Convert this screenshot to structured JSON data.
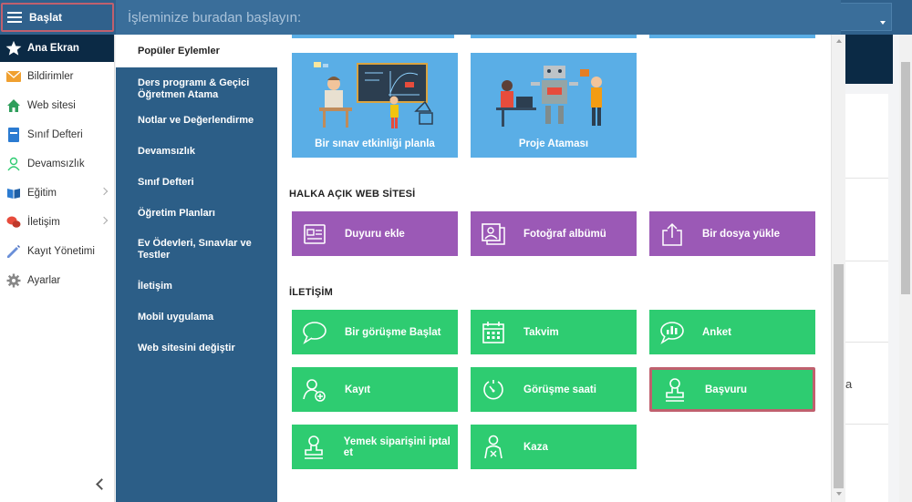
{
  "topbar": {
    "start_label": "Başlat",
    "search_placeholder": "İşleminize buradan başlayın:"
  },
  "sidebar": {
    "items": [
      {
        "label": "Ana Ekran",
        "icon": "star-icon",
        "active": true
      },
      {
        "label": "Bildirimler",
        "icon": "envelope-icon"
      },
      {
        "label": "Web sitesi",
        "icon": "home-icon"
      },
      {
        "label": "Sınıf Defteri",
        "icon": "notebook-icon"
      },
      {
        "label": "Devamsızlık",
        "icon": "person-icon"
      },
      {
        "label": "Eğitim",
        "icon": "book-icon",
        "has_submenu": true
      },
      {
        "label": "İletişim",
        "icon": "chat-icon",
        "has_submenu": true
      },
      {
        "label": "Kayıt Yönetimi",
        "icon": "pencil-icon"
      },
      {
        "label": "Ayarlar",
        "icon": "gear-icon"
      }
    ]
  },
  "categories": [
    {
      "label": "Popüler Eylemler",
      "active": true
    },
    {
      "label": "Ders programı & Geçici Öğretmen Atama"
    },
    {
      "label": "Notlar ve Değerlendirme"
    },
    {
      "label": "Devamsızlık"
    },
    {
      "label": "Sınıf Defteri"
    },
    {
      "label": "Öğretim Planları"
    },
    {
      "label": "Ev Ödevleri, Sınavlar ve Testler"
    },
    {
      "label": "İletişim"
    },
    {
      "label": "Mobil uygulama"
    },
    {
      "label": "Web sitesini değiştir"
    }
  ],
  "popular": {
    "tiles": [
      {
        "label": "Bir sınav etkinliği planla"
      },
      {
        "label": "Proje Ataması"
      }
    ]
  },
  "website": {
    "title": "HALKA AÇIK WEB SİTESİ",
    "tiles": [
      {
        "label": "Duyuru ekle",
        "icon": "announcement-icon"
      },
      {
        "label": "Fotoğraf albümü",
        "icon": "photo-album-icon"
      },
      {
        "label": "Bir dosya yükle",
        "icon": "upload-icon"
      }
    ]
  },
  "communication": {
    "title": "İLETİŞİM",
    "tiles": [
      {
        "label": "Bir görüşme Başlat",
        "icon": "speech-bubble-icon"
      },
      {
        "label": "Takvim",
        "icon": "calendar-icon"
      },
      {
        "label": "Anket",
        "icon": "poll-icon"
      },
      {
        "label": "Kayıt",
        "icon": "add-user-icon"
      },
      {
        "label": "Görüşme saati",
        "icon": "timer-icon"
      },
      {
        "label": "Başvuru",
        "icon": "stamp-icon",
        "highlighted": true
      },
      {
        "label": "Yemek siparişini iptal et",
        "icon": "stamp-icon"
      },
      {
        "label": "Kaza",
        "icon": "injury-icon"
      }
    ]
  },
  "background_page": {
    "partial_text": "a"
  },
  "colors": {
    "topbar": "#30618c",
    "category_menu": "#2c5e87",
    "active_sidebar": "#0b2a45",
    "tile_blue": "#5aaee6",
    "tile_purple": "#9b59b6",
    "tile_green": "#2ecc71",
    "highlight": "#c0606e"
  }
}
